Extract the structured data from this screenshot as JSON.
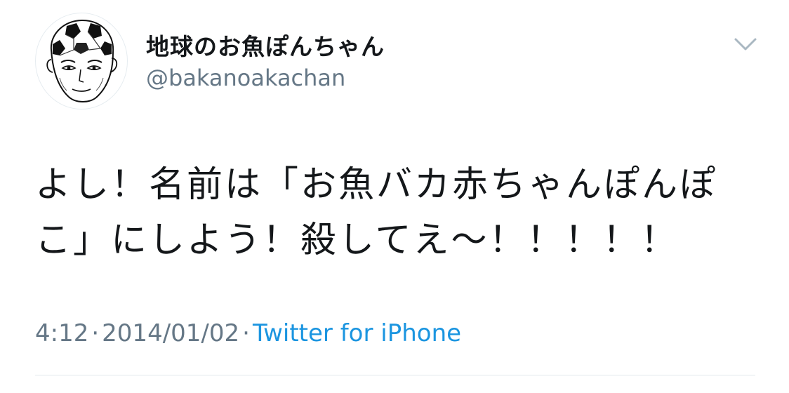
{
  "tweet": {
    "author": {
      "display_name": "地球のお魚ぽんちゃん",
      "handle": "@bakanoakachan",
      "avatar_icon": "soccer-ball-head-portrait"
    },
    "text": "よし！名前は「お魚バカ赤ちゃんぽんぽ\nこ」にしよう！殺してえ〜！！！！！",
    "time": "4:12",
    "date": "2014/01/02",
    "separator": "·",
    "source": "Twitter for iPhone",
    "menu_icon": "chevron-down-icon"
  },
  "colors": {
    "text": "#14171a",
    "secondary": "#657786",
    "link": "#1b95e0",
    "divider": "#e1e8ed",
    "chevron": "#aab8c2"
  }
}
